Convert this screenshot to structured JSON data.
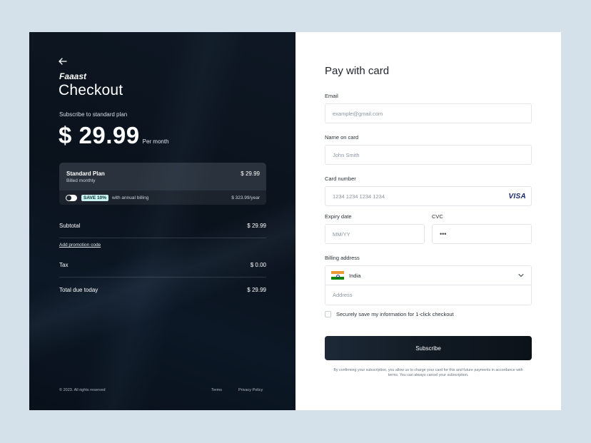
{
  "left": {
    "brand": "Faaast",
    "title": "Checkout",
    "subscribe_to": "Subscribe to standard plan",
    "price": "$ 29.99",
    "per": "Per month",
    "plan": {
      "name": "Standard Plan",
      "billed": "Billed monthly",
      "price": "$ 29.99",
      "save_badge": "SAVE 10%",
      "annual_text": "with annual billing",
      "annual_price": "$ 323.99/year"
    },
    "subtotal_label": "Subtotal",
    "subtotal_value": "$ 29.99",
    "promo_link": "Add promotion code",
    "tax_label": "Tax",
    "tax_value": "$ 0.00",
    "total_label": "Total due today",
    "total_value": "$ 29.99",
    "footer": {
      "copyright": "© 2023. All rights reserved",
      "terms": "Terms",
      "privacy": "Privacy Policy"
    }
  },
  "right": {
    "title": "Pay with card",
    "email_label": "Email",
    "email_placeholder": "example@gmail.com",
    "name_label": "Name on card",
    "name_placeholder": "John Smith",
    "card_label": "Card number",
    "card_placeholder": "1234 1234 1234 1234",
    "card_brand": "VISA",
    "expiry_label": "Expiry date",
    "expiry_placeholder": "MM/YY",
    "cvc_label": "CVC",
    "cvc_placeholder": "•••",
    "billing_label": "Billing address",
    "country": "India",
    "address_placeholder": "Address",
    "save_info": "Securely save my information for 1-click checkout",
    "subscribe_button": "Subscribe",
    "confirm_text": "By confirming your subscription, you allow us to charge your card for this and future payments in accordance with terms. You can always cancel your subscription."
  },
  "colors": {
    "left_bg": "#0a121c",
    "card_bg": "#2a333d",
    "badge_bg": "#c7f0ef",
    "button_bg": "#101922",
    "page_bg": "#d5e1ea",
    "flag_saffron": "#f09a36",
    "flag_green": "#138808"
  },
  "icons": {
    "back": "arrow-left-icon",
    "chevron": "chevron-down-icon",
    "flag": "india-flag-icon"
  }
}
